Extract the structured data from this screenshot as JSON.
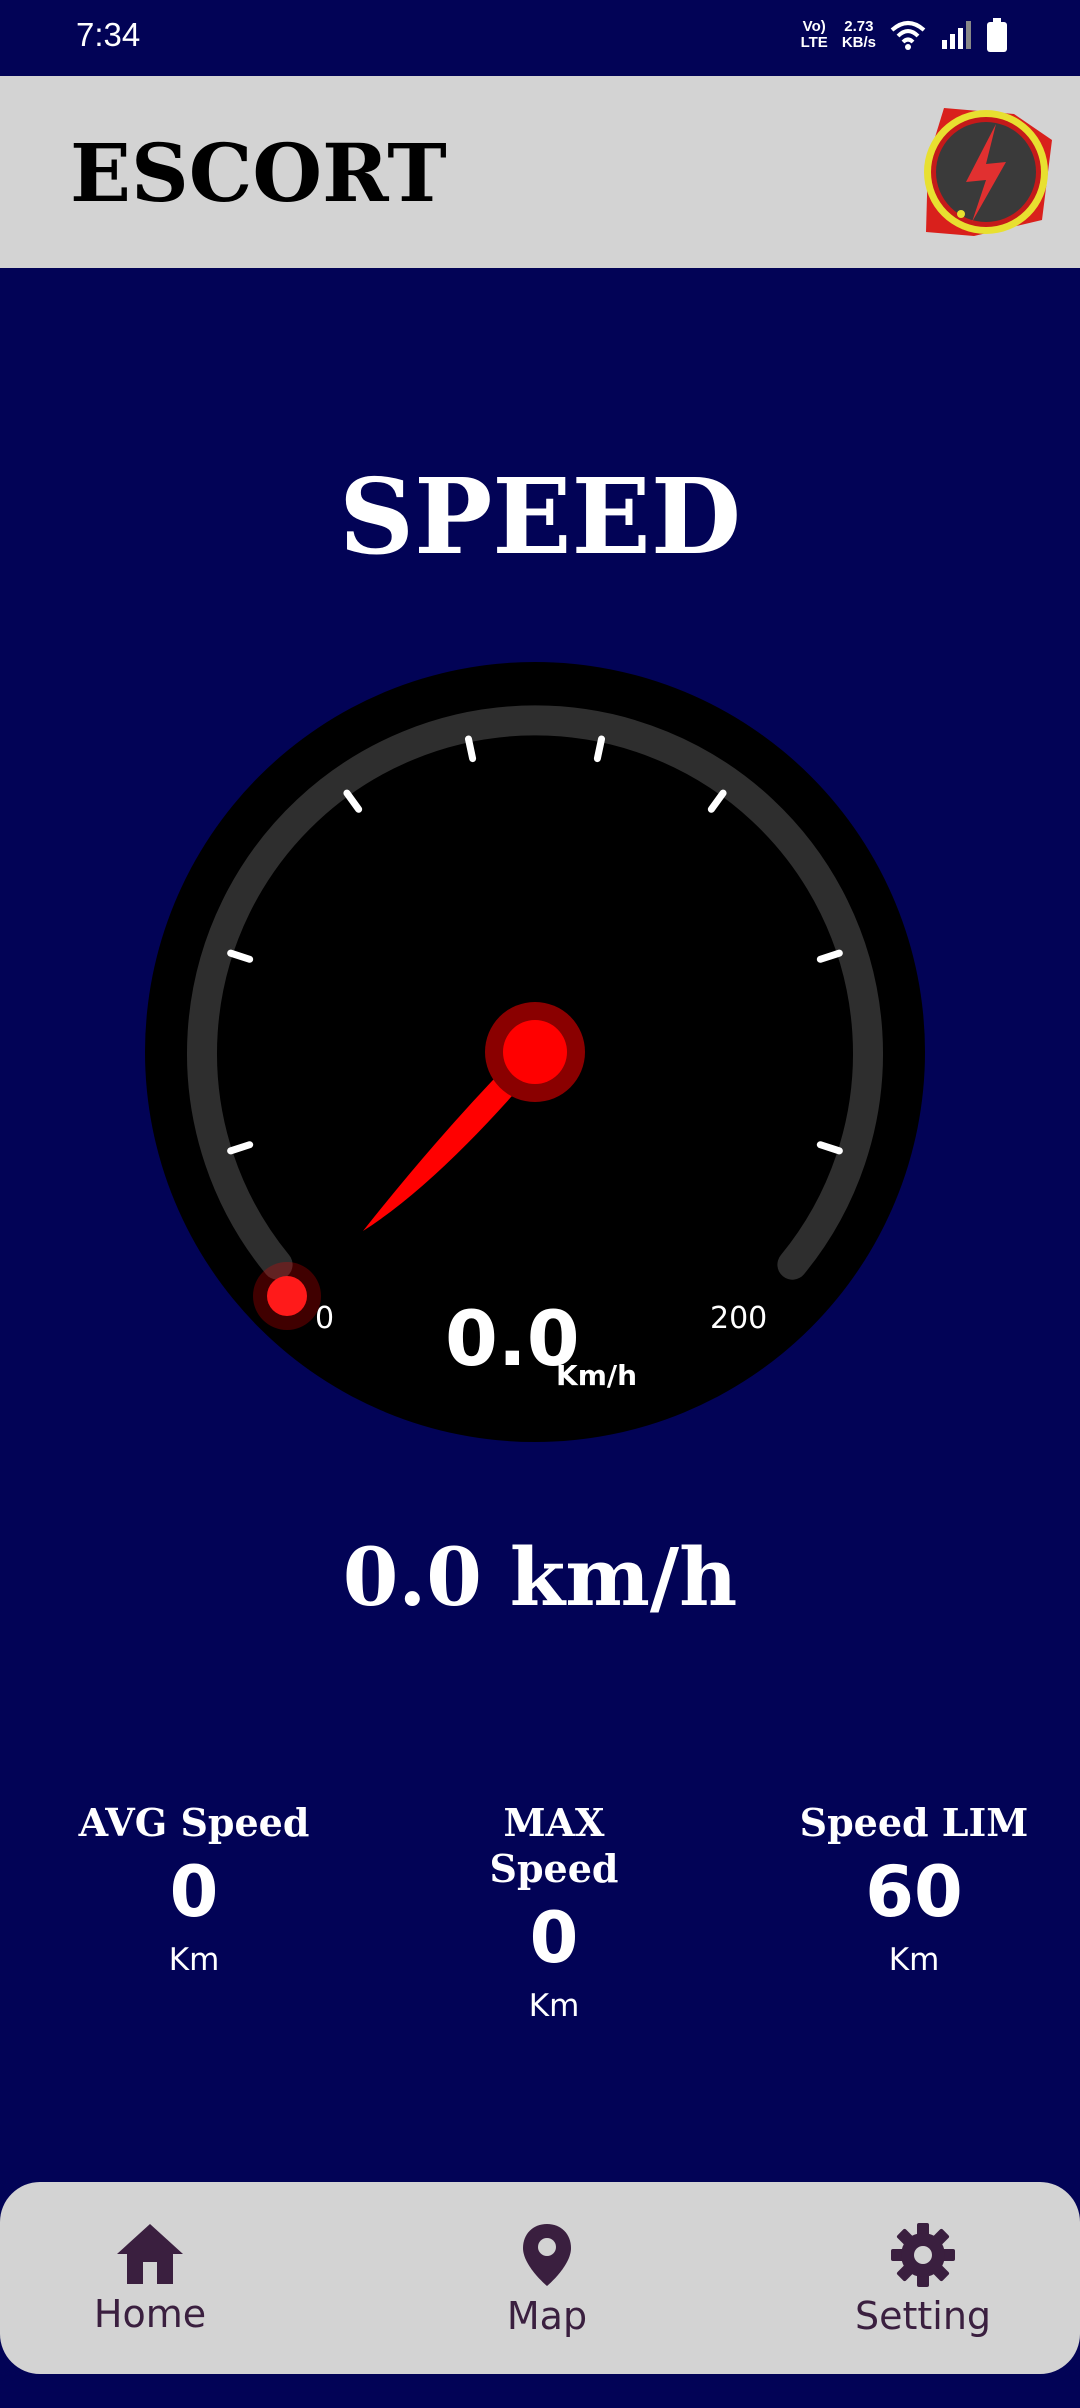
{
  "status": {
    "time": "7:34",
    "volte_top": "Vo)",
    "volte_bottom": "LTE",
    "speed_value": "2.73",
    "speed_unit": "KB/s",
    "icons": [
      "wifi-icon",
      "signal-icon",
      "battery-icon"
    ]
  },
  "header": {
    "title": "ESCORT",
    "logo_icon": "lightning-bolt-icon"
  },
  "main": {
    "heading": "SPEED",
    "gauge": {
      "min_label": "0",
      "max_label": "200",
      "value": "0.0",
      "unit": "Km/h",
      "needle_fraction": 0.0
    },
    "speed_readout": "0.0 km/h"
  },
  "stats": [
    {
      "label": "AVG Speed",
      "value": "0",
      "unit": "Km"
    },
    {
      "label_line1": "MAX",
      "label_line2": "Speed",
      "value": "0",
      "unit": "Km"
    },
    {
      "label": "Speed LIM",
      "value": "60",
      "unit": "Km"
    }
  ],
  "nav": {
    "items": [
      {
        "label": "Home",
        "icon": "home-icon"
      },
      {
        "label": "Map",
        "icon": "map-pin-icon"
      },
      {
        "label": "Setting",
        "icon": "gear-icon"
      }
    ]
  },
  "colors": {
    "background": "#020356",
    "bar": "#d3d3d3",
    "needle": "#ff0000",
    "nav_icon": "#3a1f3f"
  }
}
